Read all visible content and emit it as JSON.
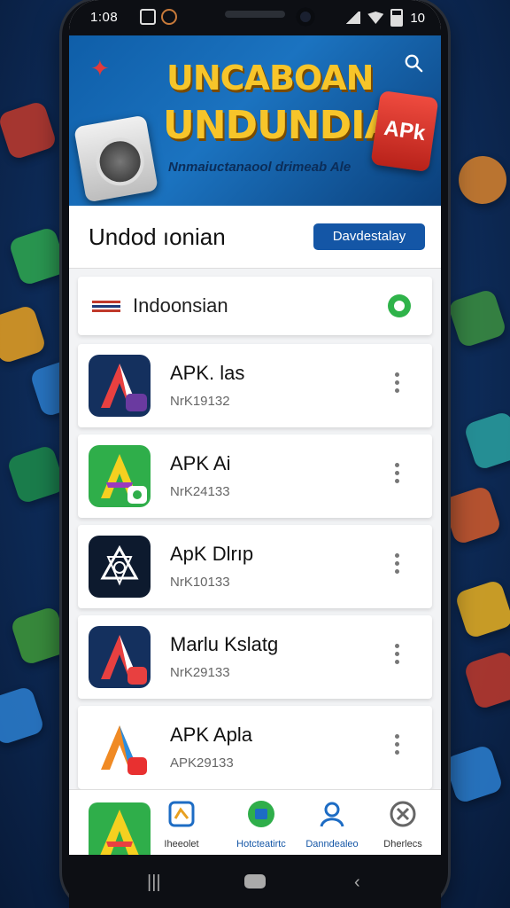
{
  "status_bar": {
    "time": "1:08",
    "battery": "10"
  },
  "banner": {
    "title_line1": "UNCABOAN",
    "title_line2": "UNDUNDIA",
    "subtitle": "Nnmaiuctanaool drimeab Ale",
    "apk_label": "APk"
  },
  "header": {
    "title": "Undod ıonian",
    "button_label": "Davdestalay"
  },
  "language_row": {
    "label": "Indoonsian"
  },
  "apps": [
    {
      "name": "APK. las",
      "code": "NrK19132"
    },
    {
      "name": "APK Ai",
      "code": "NrK24133"
    },
    {
      "name": "ApK Dlrıp",
      "code": "NrK10133"
    },
    {
      "name": "Marlu Kslatg",
      "code": "NrK29133"
    },
    {
      "name": "APK Apla",
      "code": "APK29133"
    }
  ],
  "bottom_nav": [
    {
      "label": "Iheeolet"
    },
    {
      "label": "Hotcteatirtc"
    },
    {
      "label": "Danndealeo"
    },
    {
      "label": "Dherlecs"
    }
  ],
  "colors": {
    "accent": "#1456a6",
    "banner_title": "#f7c52a",
    "green": "#2fb34a",
    "red": "#e23b3b"
  }
}
